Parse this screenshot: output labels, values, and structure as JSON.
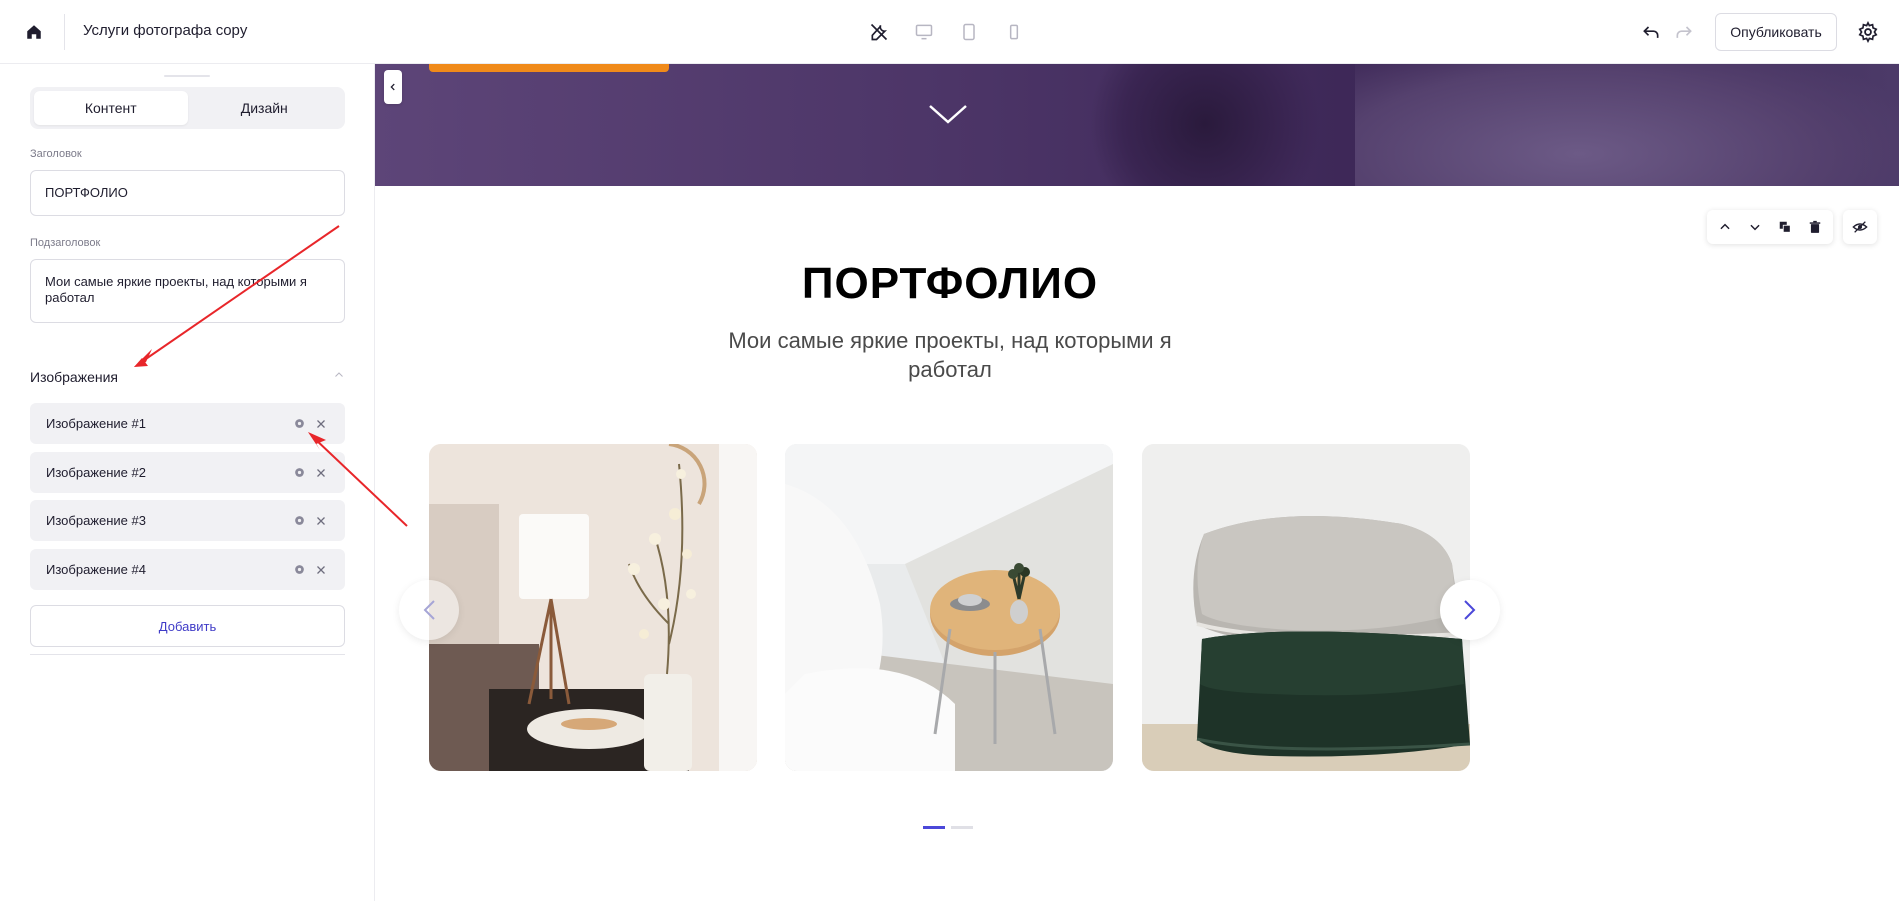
{
  "topbar": {
    "site_title": "Услуги фотографа copy",
    "publish_label": "Опубликовать",
    "device_icons": [
      "tools-icon",
      "desktop-icon",
      "tablet-icon",
      "mobile-icon"
    ]
  },
  "sidebar": {
    "tabs": [
      {
        "label": "Контент",
        "active": true
      },
      {
        "label": "Дизайн",
        "active": false
      }
    ],
    "title_field": {
      "label": "Заголовок",
      "value": "ПОРТФОЛИО"
    },
    "subtitle_field": {
      "label": "Подзаголовок",
      "value": "Мои самые яркие проекты, над которыми я работал"
    },
    "images_section": {
      "label": "Изображения"
    },
    "images": [
      {
        "name": "Изображение #1"
      },
      {
        "name": "Изображение #2"
      },
      {
        "name": "Изображение #3"
      },
      {
        "name": "Изображение #4"
      }
    ],
    "add_label": "Добавить"
  },
  "canvas": {
    "portfolio_title": "ПОРТФОЛИО",
    "portfolio_subtitle": "Мои самые яркие проекты, над которыми я работал",
    "slides": [
      "interior-lamp-flowers",
      "white-chair-coffee-table",
      "pillows"
    ],
    "pagination": {
      "count": 2,
      "active": 1
    }
  },
  "colors": {
    "accent": "#4b48d9",
    "hero_purple": "#4b3466",
    "hero_button": "#f08a1a",
    "annotation_arrow": "#e8262a"
  }
}
